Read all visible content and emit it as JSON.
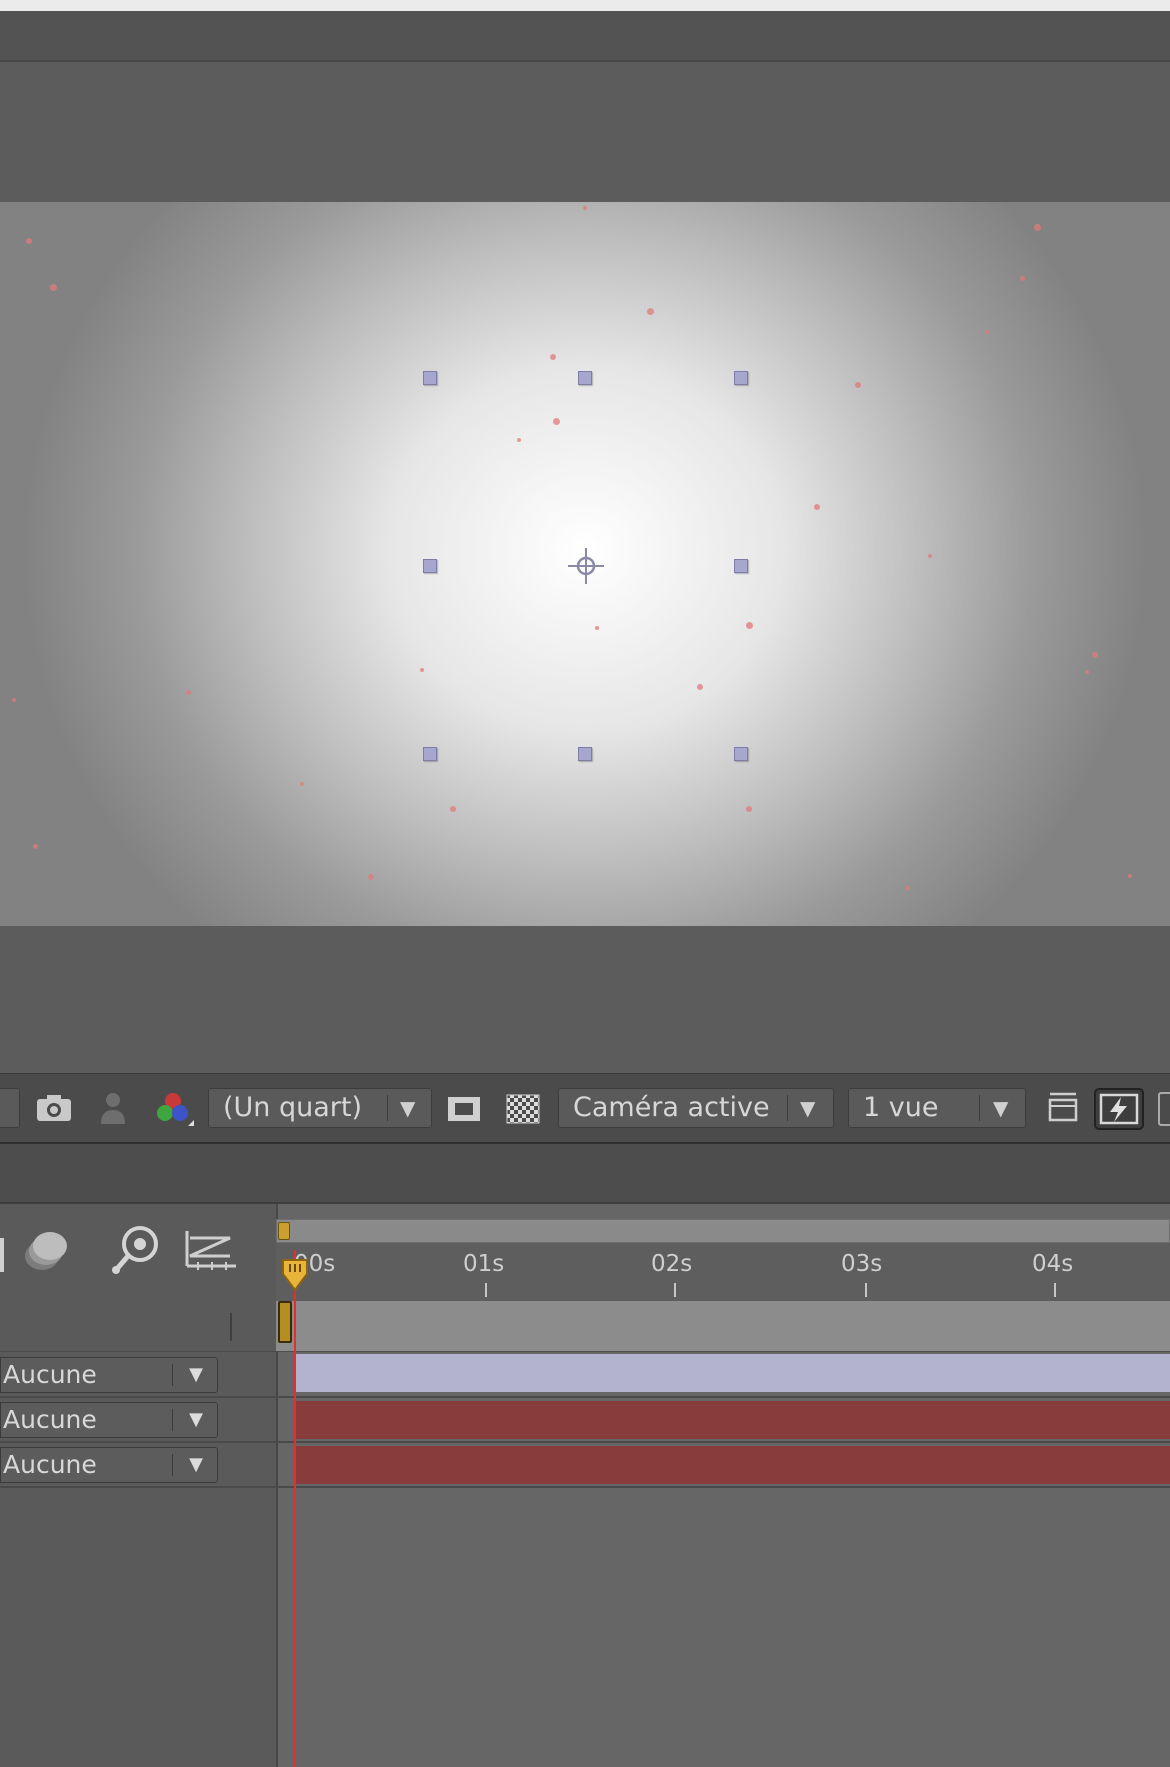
{
  "viewer_toolbar": {
    "resolution_label": "(Un quart)",
    "camera_label": "Caméra active",
    "views_label": "1 vue"
  },
  "timeline": {
    "ruler": [
      "00s",
      "01s",
      "02s",
      "03s",
      "04s"
    ],
    "layers": [
      {
        "parent": "Aucune",
        "bar_color": "#b3b3cf"
      },
      {
        "parent": "Aucune",
        "bar_color": "#893c3c"
      },
      {
        "parent": "Aucune",
        "bar_color": "#893c3c"
      }
    ]
  },
  "colors": {
    "playhead": "#e13030",
    "handle": "#a6a6cf",
    "panel_bg": "#5a5a5a"
  }
}
